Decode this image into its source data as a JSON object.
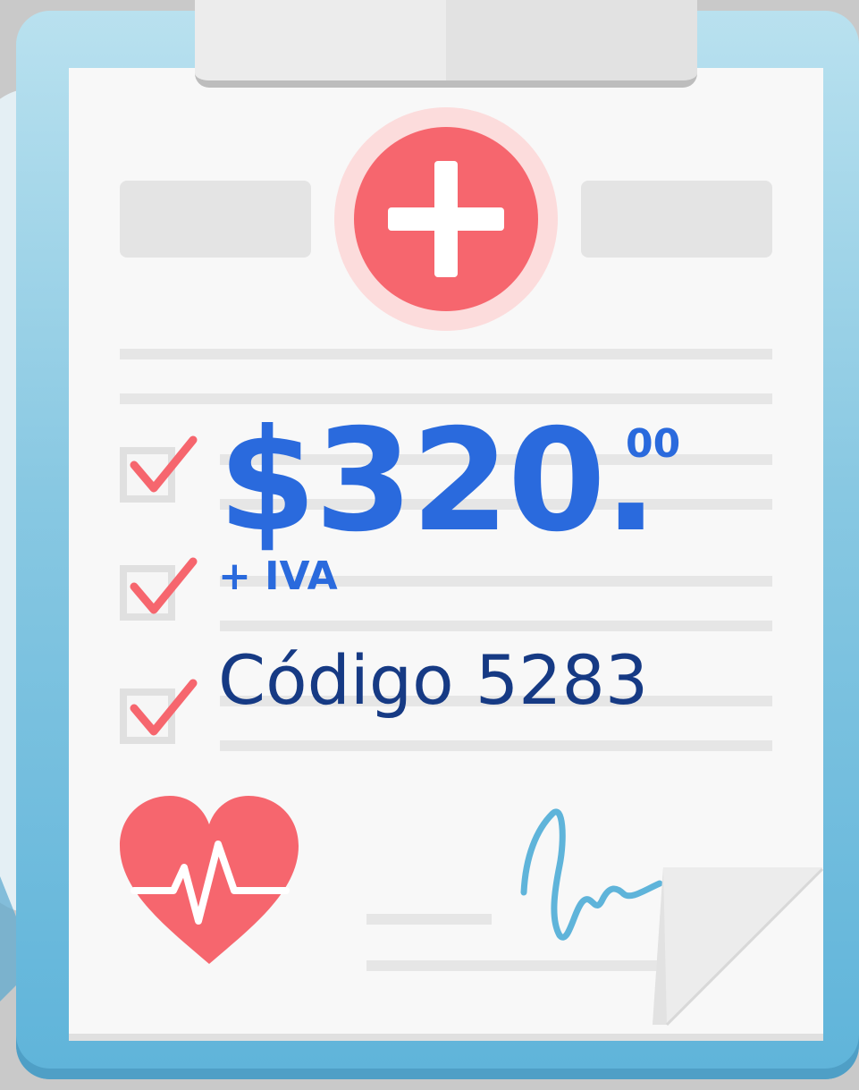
{
  "price": {
    "amount": "$320.",
    "cents": "00",
    "tax_note": "+ IVA"
  },
  "code_label": "Código 5283",
  "colors": {
    "price_blue": "#2a6add",
    "code_navy": "#163a84",
    "accent_red": "#f6666e",
    "board_blue": "#5fb4da",
    "paper": "#f8f8f8"
  },
  "icons": [
    "medical-cross-icon",
    "checkmark-icon",
    "heart-pulse-icon",
    "signature-icon"
  ]
}
